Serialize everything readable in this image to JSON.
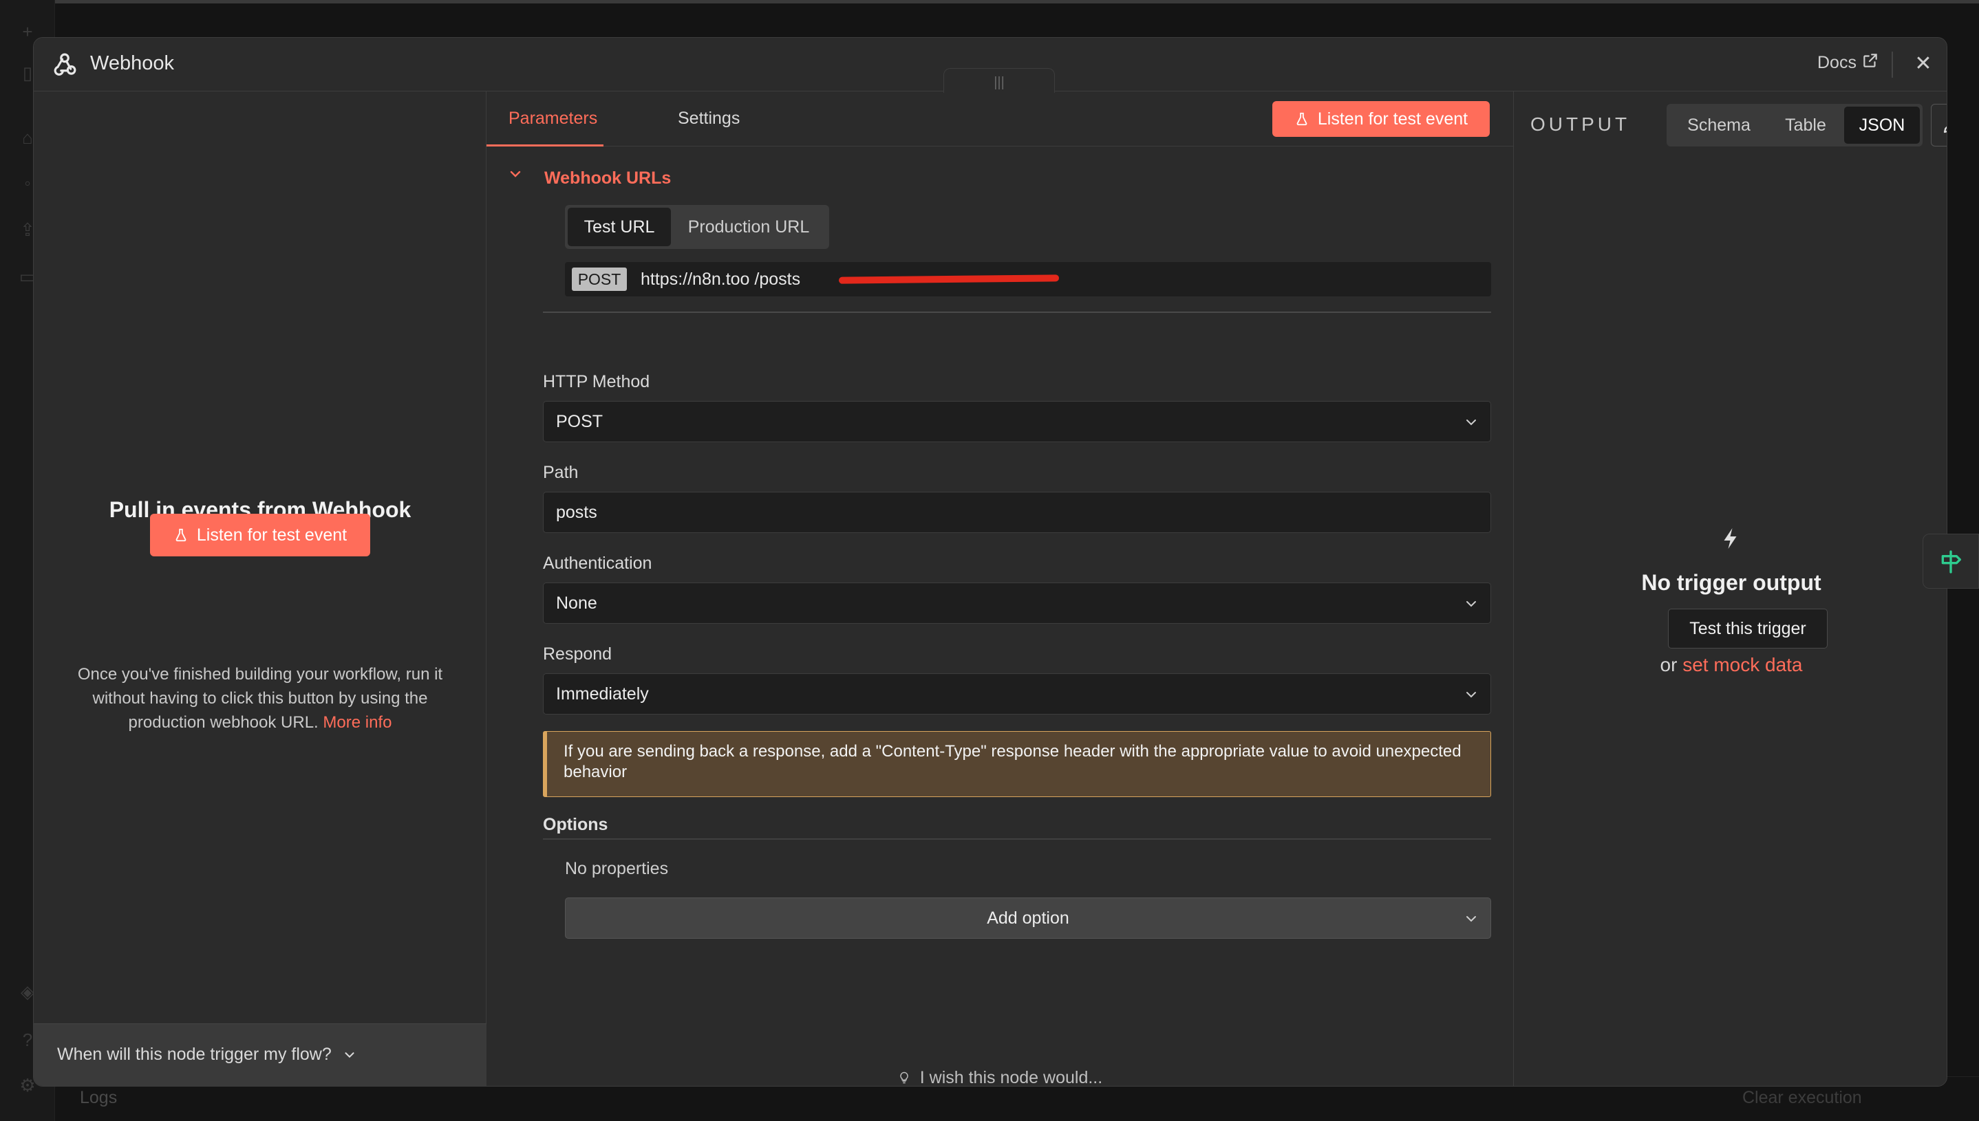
{
  "background": {
    "logs_label": "Logs",
    "clear_execution_label": "Clear execution"
  },
  "header": {
    "title": "Webhook",
    "docs_label": "Docs"
  },
  "left_pane": {
    "title": "Pull in events from Webhook",
    "listen_button": "Listen for test event",
    "description": "Once you've finished building your workflow, run it without having to click this button by using the production webhook URL.",
    "more_info": "More info",
    "footer_question": "When will this node trigger my flow?"
  },
  "tabs": {
    "parameters": "Parameters",
    "settings": "Settings",
    "listen_button": "Listen for test event",
    "drag_handle": "|||"
  },
  "webhook_urls": {
    "title": "Webhook URLs",
    "test_url_label": "Test URL",
    "production_url_label": "Production URL",
    "method_badge": "POST",
    "url": "https://n8n.too                                               /posts"
  },
  "fields": {
    "http_method": {
      "label": "HTTP Method",
      "value": "POST"
    },
    "path": {
      "label": "Path",
      "value": "posts"
    },
    "authentication": {
      "label": "Authentication",
      "value": "None"
    },
    "respond": {
      "label": "Respond",
      "value": "Immediately"
    }
  },
  "notice": "If you are sending back a response, add a \"Content-Type\" response header with the appropriate value to avoid unexpected behavior",
  "options": {
    "label": "Options",
    "no_properties": "No properties",
    "add_option": "Add option"
  },
  "wish_text": "I wish this node would...",
  "output": {
    "title": "OUTPUT",
    "views": [
      "Schema",
      "Table",
      "JSON"
    ],
    "active_view": "JSON",
    "empty_title": "No trigger output",
    "test_button": "Test this trigger",
    "or_text": "or",
    "mock_link": "set mock data"
  },
  "colors": {
    "accent": "#ff6d5a",
    "panel": "#2b2b2b",
    "input_bg": "#1e1e1e",
    "notice_bg": "#574531",
    "notice_border": "#d9a55d"
  }
}
